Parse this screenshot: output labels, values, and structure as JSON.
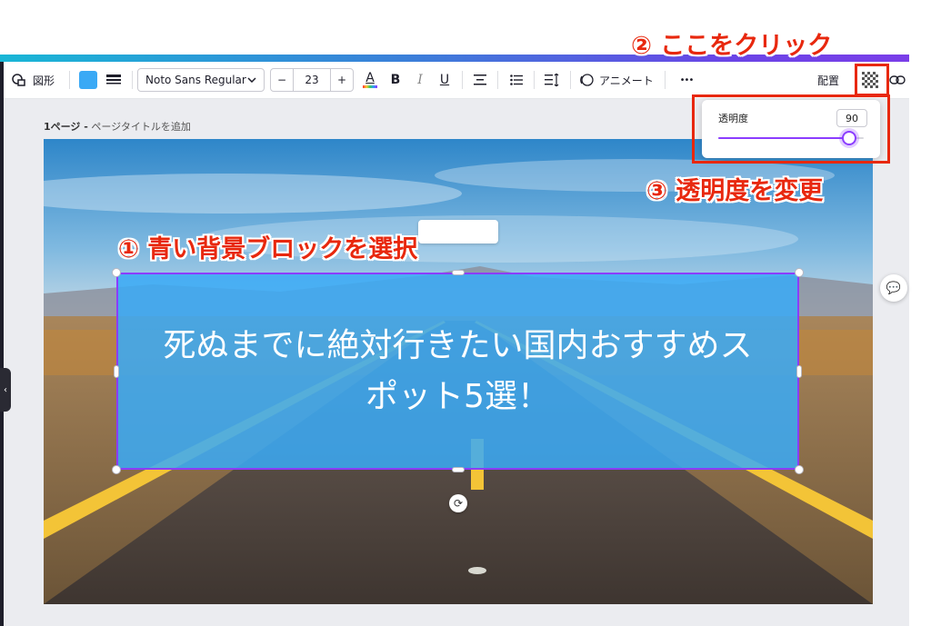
{
  "toolbar": {
    "shape_label": "図形",
    "font_name": "Noto Sans Regular",
    "font_size": "23",
    "minus": "−",
    "plus": "+",
    "text_color_glyph": "A",
    "bold_glyph": "B",
    "italic_glyph": "I",
    "underline_glyph": "U",
    "animate_label": "アニメート",
    "more_glyph": "•••",
    "position_label": "配置",
    "fill_color": "#3aa9f5"
  },
  "page": {
    "page_number": "1ページ -",
    "title_placeholder": "ページタイトルを追加"
  },
  "textbox": {
    "text": "死ぬまでに絶対行きたい国内おすすめスポット5選！",
    "background_color": "#3aa9f5"
  },
  "transparency": {
    "label": "透明度",
    "value": "90",
    "level": 0.9
  },
  "annotations": {
    "step1": "① 青い背景ブロックを選択",
    "step2": "② ここをクリック",
    "step3": "③ 透明度を変更",
    "color": "#e8280e"
  },
  "icons": {
    "shape": "shapes-icon",
    "border": "border-style-icon",
    "align": "text-align-center-icon",
    "list": "bullet-list-icon",
    "spacing": "line-spacing-icon",
    "transparency": "transparency-checker-icon",
    "link": "link-icon",
    "comment": "add-comment-icon",
    "rotate": "rotate-icon",
    "sidebar": "collapse-chevron-icon"
  }
}
